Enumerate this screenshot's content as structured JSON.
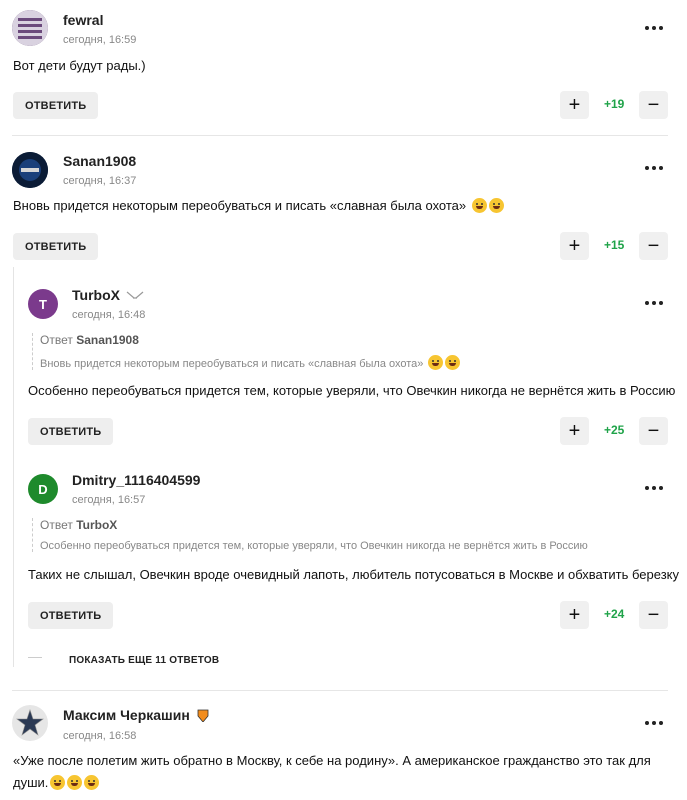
{
  "comments": [
    {
      "author": "fewral",
      "time": "сегодня, 16:59",
      "text": "Вот дети будут рады.)",
      "reply_label": "ОТВЕТИТЬ",
      "score": "+19"
    },
    {
      "author": "Sanan1908",
      "time": "сегодня, 16:37",
      "text": "Вновь придется некоторым переобуваться и писать «славная была охота»",
      "reply_label": "ОТВЕТИТЬ",
      "score": "+15",
      "replies": [
        {
          "avatar_letter": "T",
          "avatar_color": "#7b3a8c",
          "author": "TurboX",
          "time": "сегодня, 16:48",
          "quote_prefix": "Ответ",
          "quote_author": "Sanan1908",
          "quote_text": "Вновь придется некоторым переобуваться и писать «славная была охота»",
          "text": "Особенно переобуваться придется тем, которые уверяли, что Овечкин никогда не вернётся жить в Россию",
          "reply_label": "ОТВЕТИТЬ",
          "score": "+25"
        },
        {
          "avatar_letter": "D",
          "avatar_color": "#1e8a2c",
          "author": "Dmitry_1116404599",
          "time": "сегодня, 16:57",
          "quote_prefix": "Ответ",
          "quote_author": "TurboX",
          "quote_text": "Особенно переобуваться придется тем, которые уверяли, что Овечкин никогда не вернётся жить в Россию",
          "text": "Таких не слышал, Овечкин вроде очевидный лапоть, любитель потусоваться в Москве и обхватить березку",
          "reply_label": "ОТВЕТИТЬ",
          "score": "+24"
        }
      ],
      "show_more_label": "ПОКАЗАТЬ ЕЩЕ 11 ОТВЕТОВ"
    },
    {
      "author": "Максим Черкашин",
      "time": "сегодня, 16:58",
      "text_line1": "«Уже после полетим жить обратно в Москву, к себе на родину». А американское гражданство это так для",
      "text_line2": "души."
    }
  ],
  "colors": {
    "score": "#1fa349",
    "button_bg": "#eeeeee"
  },
  "icons": [
    "more-icon",
    "plus-icon",
    "minus-icon",
    "emoji-icon"
  ]
}
